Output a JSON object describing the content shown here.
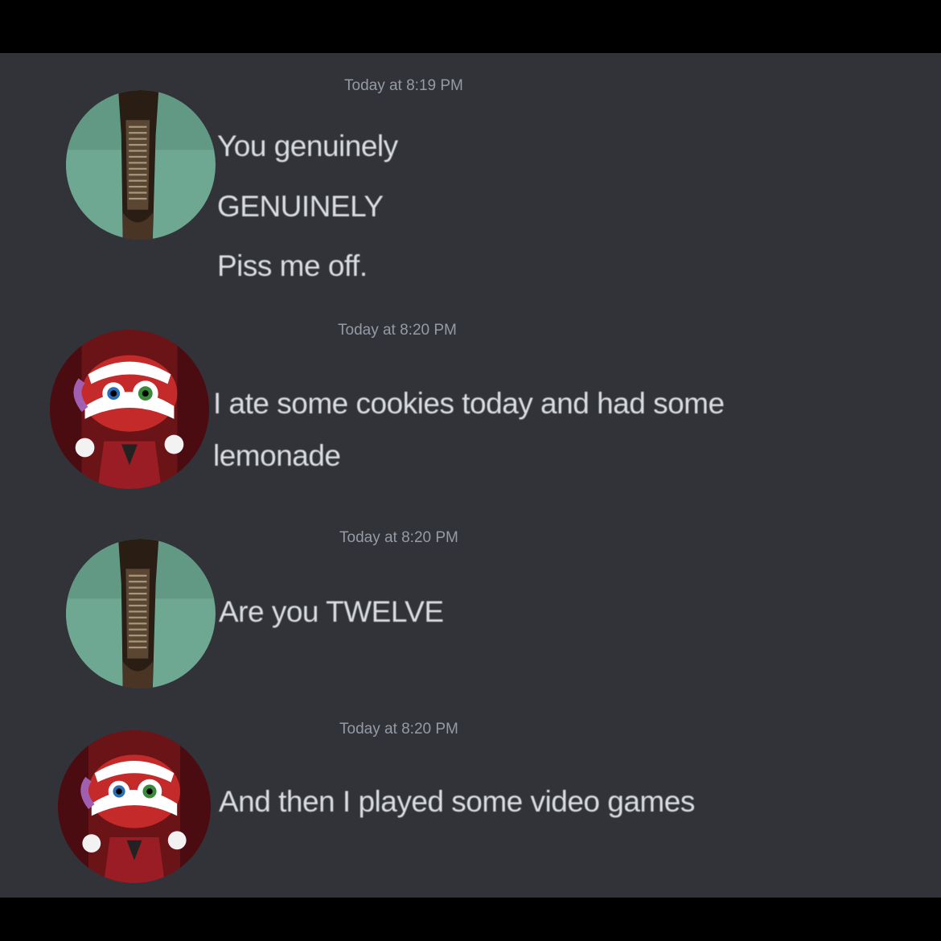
{
  "messages": [
    {
      "timestamp": "Today at 8:19 PM",
      "avatar": "tree-trunk-avatar-icon",
      "lines": [
        "You genuinely",
        "GENUINELY",
        "Piss me off."
      ]
    },
    {
      "timestamp": "Today at 8:20 PM",
      "avatar": "jester-character-avatar-icon",
      "lines": [
        "I ate some cookies today and had some",
        "lemonade"
      ]
    },
    {
      "timestamp": "Today at 8:20 PM",
      "avatar": "tree-trunk-avatar-icon",
      "lines": [
        "Are you TWELVE"
      ]
    },
    {
      "timestamp": "Today at 8:20 PM",
      "avatar": "jester-character-avatar-icon",
      "lines": [
        "And then I played some video games"
      ]
    }
  ],
  "colors": {
    "background": "#313338",
    "letterbox": "#000000",
    "text": "#dbdee1",
    "timestamp": "#949ba4"
  }
}
